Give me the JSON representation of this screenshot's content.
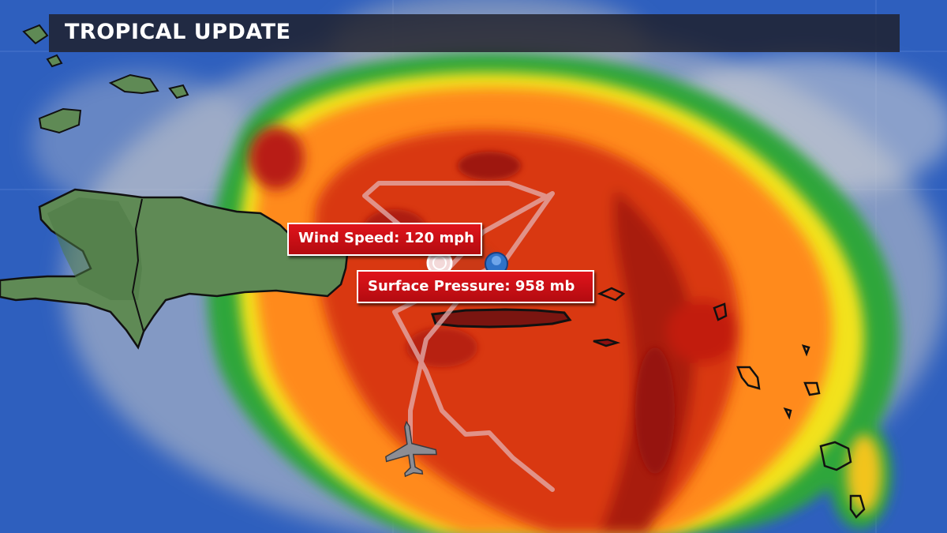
{
  "header": {
    "title": "TROPICAL UPDATE"
  },
  "annotations": {
    "wind_speed": "Wind Speed: 120 mph",
    "surface_pressure": "Surface Pressure: 958 mb"
  },
  "colors": {
    "ocean": "#2a5bb8",
    "land": "#5f8a55",
    "radar_light": "#2fa63a",
    "radar_moderate": "#f2e21e",
    "radar_heavy": "#ff8a1c",
    "radar_intense": "#d22a12",
    "radar_extreme": "#8e1010",
    "label_fill": "#d0141a"
  },
  "icons": [
    "aircraft-icon",
    "storm-center-icon",
    "gps-marker-icon"
  ]
}
